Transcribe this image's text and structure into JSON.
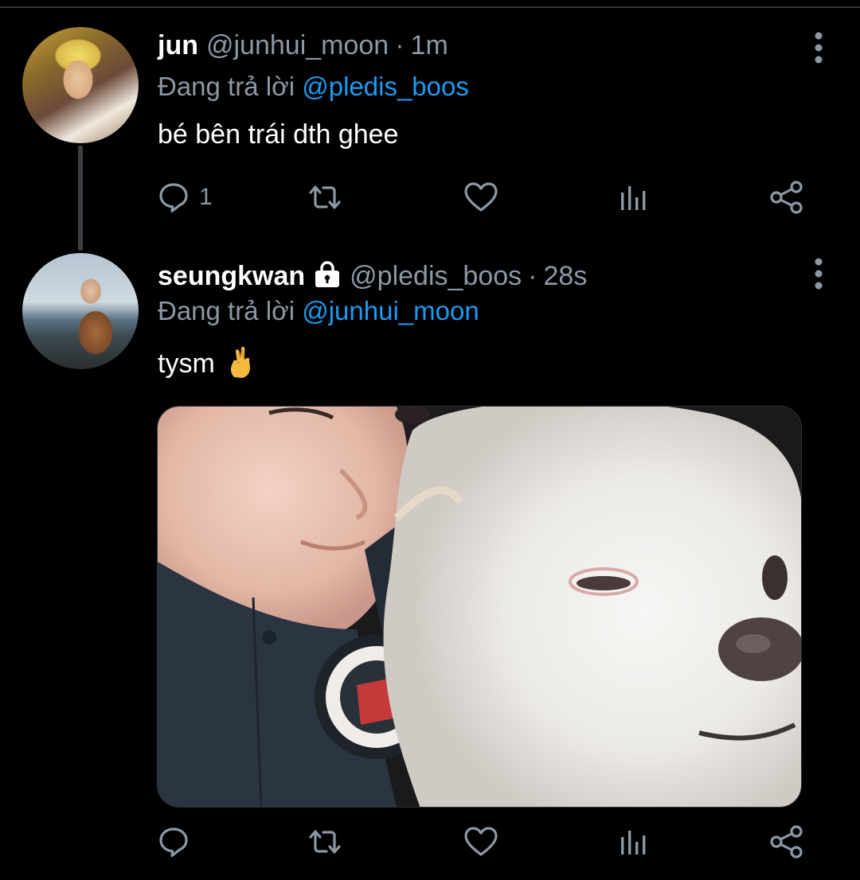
{
  "tweets": [
    {
      "name": "jun",
      "handle": "@junhui_moon",
      "separator": "·",
      "time": "1m",
      "reply_prefix": "Đang trả lời",
      "reply_to": "@pledis_boos",
      "text": "bé bên trái dth ghee",
      "reply_count": "1",
      "avatar_icon": "profile-photo-blonde",
      "protected": false
    },
    {
      "name": "seungkwan",
      "handle": "@pledis_boos",
      "separator": "·",
      "time": "28s",
      "reply_prefix": "Đang trả lời",
      "reply_to": "@junhui_moon",
      "text": "tysm",
      "emoji": "crossed-fingers",
      "reply_count": "",
      "avatar_icon": "profile-photo-seaside",
      "protected": true,
      "media": "photo-person-with-white-dog"
    }
  ],
  "colors": {
    "background": "#000000",
    "primary_text": "#ffffff",
    "secondary_text": "#8b98a5",
    "mention": "#1d9bf0",
    "thread_line": "#3b3f44"
  }
}
